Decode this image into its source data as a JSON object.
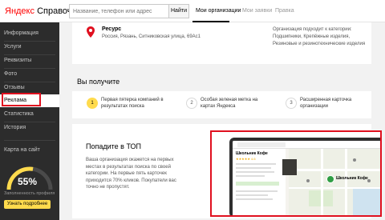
{
  "header": {
    "logo_brand": "Яндекс",
    "logo_product": "Справочник",
    "search_placeholder": "Название, телефон или адрес",
    "search_button": "Найти",
    "tabs": [
      {
        "label": "Мои организации",
        "active": true
      },
      {
        "label": "Мои заявки",
        "active": false
      },
      {
        "label": "Правка",
        "active": false
      }
    ]
  },
  "sidebar": {
    "items": [
      {
        "label": "Информация",
        "active": false
      },
      {
        "label": "Услуги",
        "active": false
      },
      {
        "label": "Реквизиты",
        "active": false
      },
      {
        "label": "Фото",
        "active": false
      },
      {
        "label": "Отзывы",
        "active": false
      },
      {
        "label": "Реклама",
        "active": true
      },
      {
        "label": "Статистика",
        "active": false
      },
      {
        "label": "История",
        "active": false
      }
    ],
    "site_map_label": "Карта на сайт",
    "profile_fill_percent": "55%",
    "profile_fill_value": 0.55,
    "profile_caption": "Заполненность профиля",
    "learn_more_button": "Узнать подробнее"
  },
  "organization": {
    "name": "Ресурс",
    "address": "Россия, Рязань, Ситниковская улица, 69Ас1",
    "categories": "Организация подходит к категории: Подшипники, Крепёжные изделия, Резиновые и резинотехнические изделия"
  },
  "benefits": {
    "title": "Вы получите",
    "items": [
      {
        "num": "1",
        "text": "Первая пятерка компаний в результатах поиска"
      },
      {
        "num": "2",
        "text": "Особая зеленая метка на картах Яндекса"
      },
      {
        "num": "3",
        "text": "Расширенная карточка организации"
      }
    ]
  },
  "promo": {
    "title": "Попадите в ТОП",
    "text": "Ваша организация окажется на первых местах в результатах поиска по своей категории. На первые пять карточек приходится 70% кликов. Покупатели вас точно не пропустят.",
    "mock_card_title": "Школьник Кофе",
    "mock_rating": "★★★★★ 4.6",
    "mock_pin_label": "Школьник Кофе"
  },
  "colors": {
    "accent_yellow": "#ffdb4d",
    "highlight_red": "#e0101f",
    "sidebar_bg": "#2c2c2c",
    "brand_red": "#ff0000"
  }
}
